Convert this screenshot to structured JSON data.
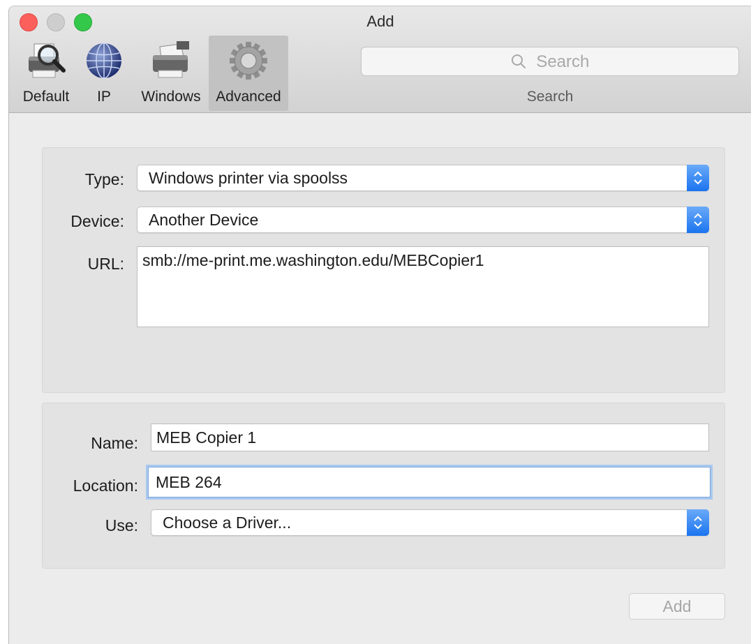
{
  "window": {
    "title": "Add"
  },
  "toolbar": {
    "items": [
      {
        "label": "Default",
        "icon": "default-printer-icon"
      },
      {
        "label": "IP",
        "icon": "ip-globe-icon"
      },
      {
        "label": "Windows",
        "icon": "windows-printer-icon"
      },
      {
        "label": "Advanced",
        "icon": "advanced-gear-icon",
        "selected": true
      }
    ],
    "search": {
      "placeholder": "Search",
      "caption": "Search"
    }
  },
  "connection": {
    "type_label": "Type:",
    "type_value": "Windows printer via spoolss",
    "device_label": "Device:",
    "device_value": "Another Device",
    "url_label": "URL:",
    "url_value": "smb://me-print.me.washington.edu/MEBCopier1"
  },
  "printer": {
    "name_label": "Name:",
    "name_value": "MEB Copier 1",
    "location_label": "Location:",
    "location_value": "MEB 264",
    "use_label": "Use:",
    "use_value": "Choose a Driver..."
  },
  "actions": {
    "add_label": "Add"
  },
  "colors": {
    "accent": "#1a74ef",
    "close": "#fc605c",
    "zoom": "#34c84a",
    "focus_ring": "#a9c8ef"
  }
}
